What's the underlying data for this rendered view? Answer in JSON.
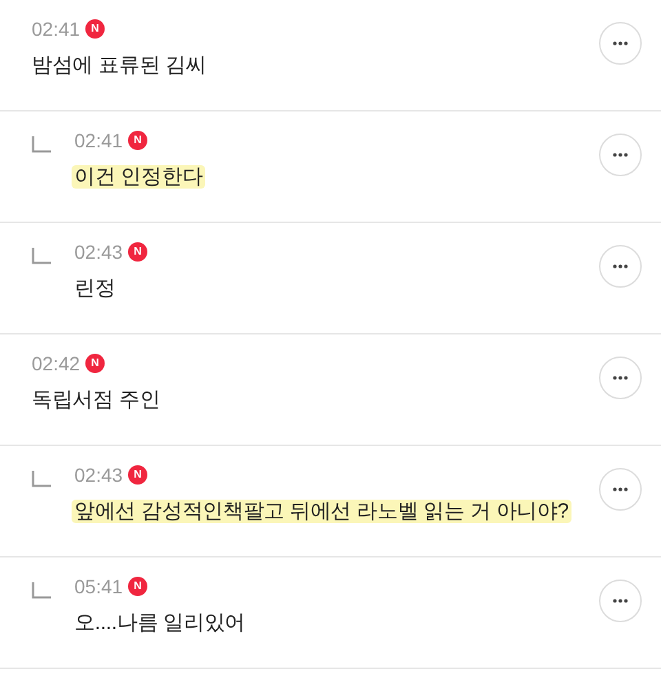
{
  "comments": [
    {
      "time": "02:41",
      "badge": "N",
      "text": "밤섬에 표류된 김씨",
      "highlighted": false,
      "children": [
        {
          "time": "02:41",
          "badge": "N",
          "text": "이건 인정한다",
          "highlighted": true
        },
        {
          "time": "02:43",
          "badge": "N",
          "text": "린정",
          "highlighted": false
        }
      ]
    },
    {
      "time": "02:42",
      "badge": "N",
      "text": "독립서점 주인",
      "highlighted": false,
      "children": [
        {
          "time": "02:43",
          "badge": "N",
          "text": "앞에선 감성적인책팔고 뒤에선 라노벨 읽는 거 아니야?",
          "highlighted": true
        },
        {
          "time": "05:41",
          "badge": "N",
          "text": "오....나름 일리있어",
          "highlighted": false
        }
      ]
    }
  ]
}
